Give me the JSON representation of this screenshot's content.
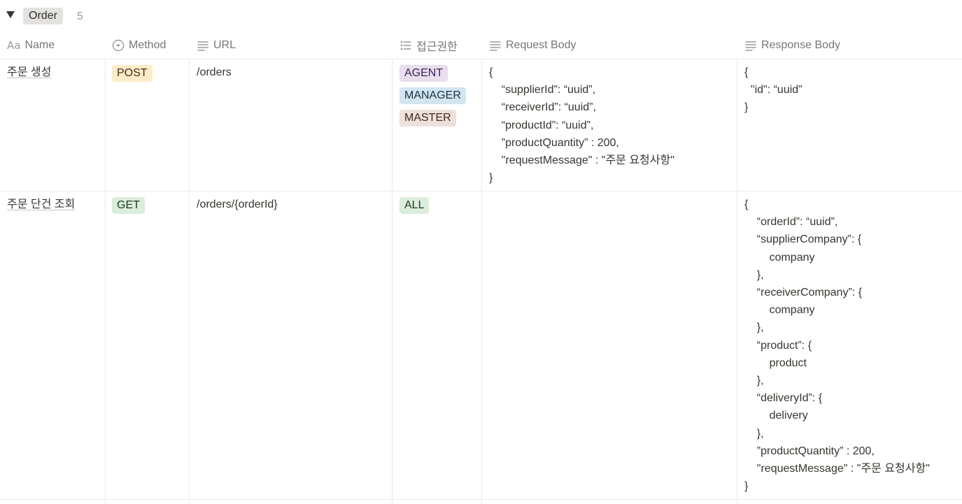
{
  "group": {
    "label": "Order",
    "count": "5"
  },
  "columns": {
    "name": {
      "icon": "text-property-icon",
      "label": "Name",
      "prefix": "Aa"
    },
    "method": {
      "icon": "select-property-icon",
      "label": "Method"
    },
    "url": {
      "icon": "text-lines-icon",
      "label": "URL"
    },
    "access": {
      "icon": "multi-select-property-icon",
      "label": "접근권한"
    },
    "request_body": {
      "icon": "text-lines-icon",
      "label": "Request Body"
    },
    "response_body": {
      "icon": "text-lines-icon",
      "label": "Response Body"
    }
  },
  "rows": [
    {
      "name": "주문 생성",
      "method": {
        "label": "POST",
        "color": "#fdecc8"
      },
      "url": "/orders",
      "access": [
        {
          "label": "AGENT",
          "color": "#e8deee"
        },
        {
          "label": "MANAGER",
          "color": "#d3e5ef"
        },
        {
          "label": "MASTER",
          "color": "#eee0da"
        }
      ],
      "request_body": "{\n    “supplierId”: “uuid”,\n    “receiverId”: “uuid”,\n    “productId”: “uuid”,\n    ”productQuantity” : 200,\n    \"requestMessage\" : \"주문 요청사항\"\n}",
      "response_body": "{\n  \"id\": “uuid”\n}"
    },
    {
      "name": "주문 단건 조회",
      "method": {
        "label": "GET",
        "color": "#dbeddb"
      },
      "url": "/orders/{orderId}",
      "access": [
        {
          "label": "ALL",
          "color": "#dbeddb"
        }
      ],
      "request_body": "",
      "response_body": "{\n    “orderId”: “uuid”,\n    “supplierCompany”: {\n        company\n    },\n    “receiverCompany”: {\n        company\n    },\n    “product”: {\n        product\n    },\n    “deliveryId”: {\n        delivery\n    },\n    ”productQuantity” : 200,\n    \"requestMessage\" : \"주문 요청사항\"\n}"
    }
  ]
}
